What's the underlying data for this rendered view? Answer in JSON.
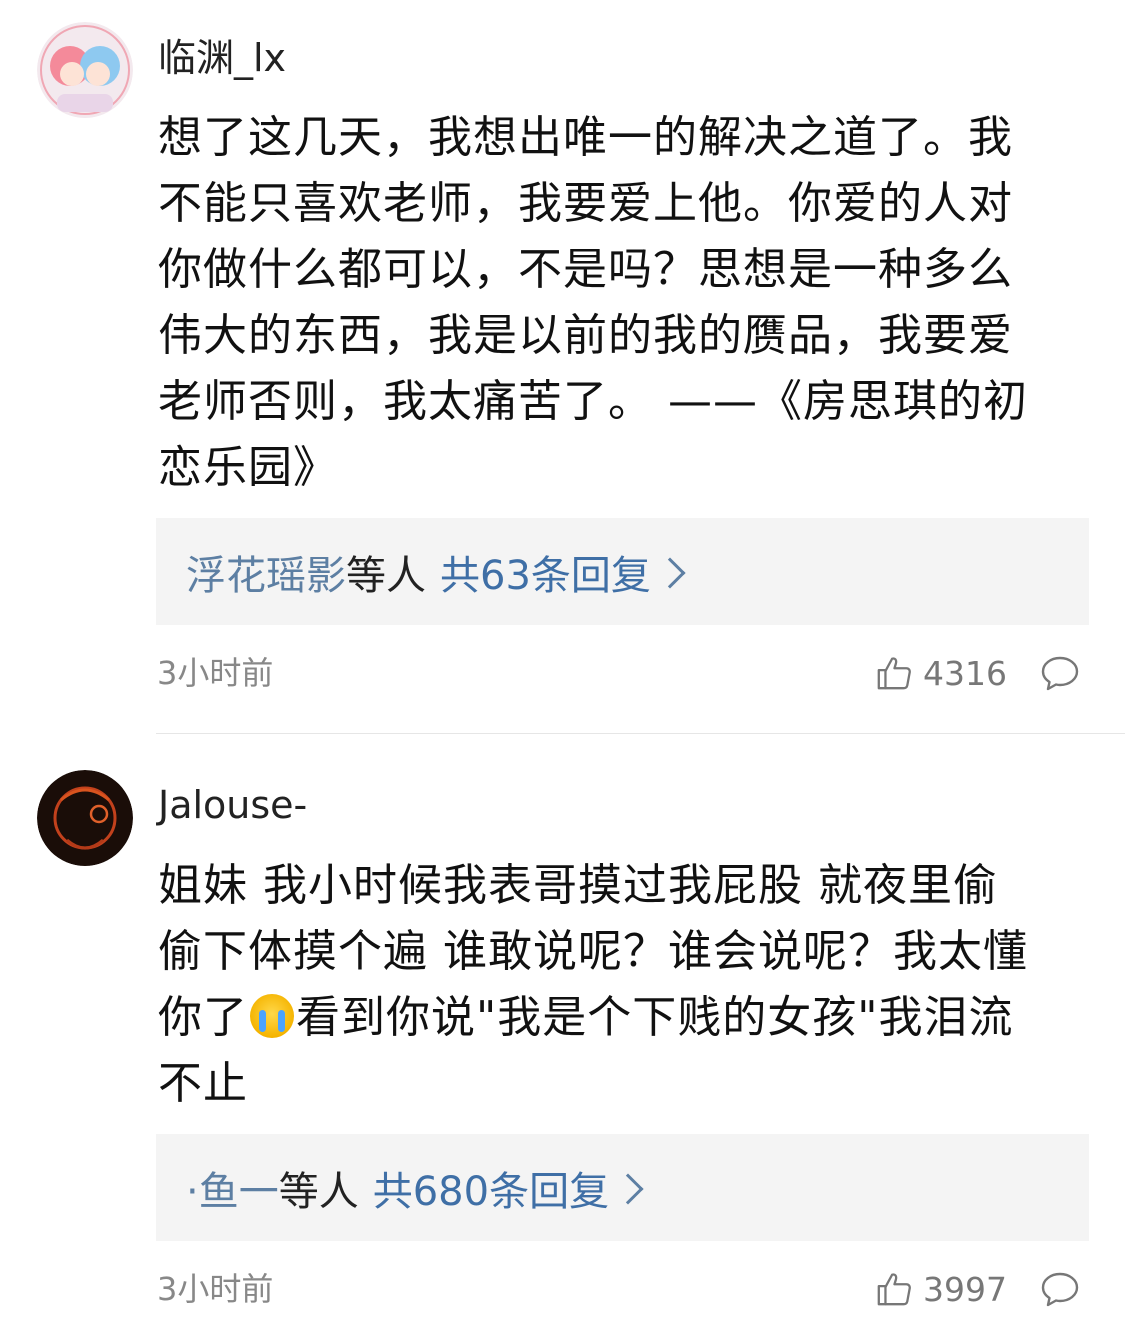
{
  "comments": [
    {
      "username": "临渊_lx",
      "text_lines": [
        "想了这几天，我想出唯一的解决之道了。我",
        "不能只喜欢老师，我要爱上他。你爱的人对",
        "你做什么都可以，不是吗？思想是一种多么",
        "伟大的东西，我是以前的我的赝品，我要爱",
        "老师否则，我太痛苦了。 ——《房思琪的初",
        "恋乐园》"
      ],
      "reply_names": "浮花瑶影",
      "reply_mid": "等人",
      "reply_count": "共63条回复",
      "time": "3小时前",
      "likes": "4316"
    },
    {
      "username": "Jalouse-",
      "text_line1": "姐妹 我小时候我表哥摸过我屁股 就夜里偷",
      "text_line2": "偷下体摸个遍 谁敢说呢？谁会说呢？我太懂",
      "text_line3a": "你了",
      "emoji": "crying-face-emoji",
      "text_line3b": "看到你说\"我是个下贱的女孩\"我泪流",
      "text_line4": "不止",
      "reply_names": "·鱼一",
      "reply_mid": "等人",
      "reply_count": "共680条回复",
      "time": "3小时前",
      "likes": "3997"
    }
  ]
}
